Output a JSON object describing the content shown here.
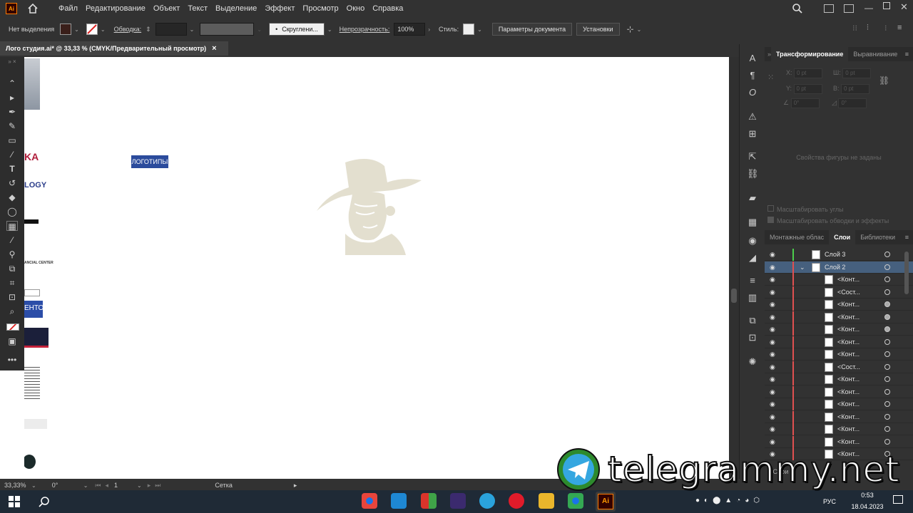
{
  "app": {
    "logo_text": "Ai",
    "menu": [
      "Файл",
      "Редактирование",
      "Объект",
      "Текст",
      "Выделение",
      "Эффект",
      "Просмотр",
      "Окно",
      "Справка"
    ]
  },
  "control_bar": {
    "selection_label": "Нет выделения",
    "stroke_label": "Обводка:",
    "brush_label": "Скруглени...",
    "opacity_label": "Непрозрачность:",
    "opacity_value": "100%",
    "style_label": "Стиль:",
    "doc_params_label": "Параметры документа",
    "settings_label": "Установки"
  },
  "document": {
    "tab_title": "Лого студия.ai* @ 33,33 % (CMYK/Предварительный просмотр)",
    "close_glyph": "×"
  },
  "canvas": {
    "badge_text": "ЛОГОТИПЫ",
    "left_snippets": [
      "KA",
      "LOGY",
      "ЕНТОВ",
      "ANCIAL CENTER"
    ]
  },
  "status_bar": {
    "zoom": "33,33%",
    "rotation": "0°",
    "artboard_number": "1",
    "grid_label": "Сетка"
  },
  "transform_panel": {
    "tabs": [
      "Трансформирование",
      "Выравнивание"
    ],
    "x_label": "X:",
    "y_label": "Y:",
    "w_label": "Ш:",
    "h_label": "В:",
    "x_value": "0 pt",
    "y_value": "0 pt",
    "w_value": "0 pt",
    "h_value": "0 pt",
    "angle_value": "0°",
    "shear_value": "0°",
    "no_shape_text": "Свойства фигуры не заданы",
    "scale_corners": "Масштабировать углы",
    "scale_strokes": "Масштабировать обводки и эффекты"
  },
  "layers_panel": {
    "tabs": [
      "Монтажные облас",
      "Слои",
      "Библиотеки"
    ],
    "rows": [
      {
        "name": "Слой 3",
        "indent": false,
        "selected": false,
        "color": "#4ccf4c",
        "target_filled": false
      },
      {
        "name": "Слой 2",
        "indent": false,
        "selected": true,
        "color": "#e05050",
        "target_filled": false
      },
      {
        "name": "<Конт...",
        "indent": true,
        "selected": false,
        "color": "#e05050",
        "target_filled": false
      },
      {
        "name": "<Сост...",
        "indent": true,
        "selected": false,
        "color": "#e05050",
        "target_filled": false
      },
      {
        "name": "<Конт...",
        "indent": true,
        "selected": false,
        "color": "#e05050",
        "target_filled": true
      },
      {
        "name": "<Конт...",
        "indent": true,
        "selected": false,
        "color": "#e05050",
        "target_filled": true
      },
      {
        "name": "<Конт...",
        "indent": true,
        "selected": false,
        "color": "#e05050",
        "target_filled": true
      },
      {
        "name": "<Конт...",
        "indent": true,
        "selected": false,
        "color": "#e05050",
        "target_filled": false
      },
      {
        "name": "<Конт...",
        "indent": true,
        "selected": false,
        "color": "#e05050",
        "target_filled": false
      },
      {
        "name": "<Сост...",
        "indent": true,
        "selected": false,
        "color": "#e05050",
        "target_filled": false
      },
      {
        "name": "<Конт...",
        "indent": true,
        "selected": false,
        "color": "#e05050",
        "target_filled": false
      },
      {
        "name": "<Конт...",
        "indent": true,
        "selected": false,
        "color": "#e05050",
        "target_filled": false
      },
      {
        "name": "<Конт...",
        "indent": true,
        "selected": false,
        "color": "#e05050",
        "target_filled": false
      },
      {
        "name": "<Конт...",
        "indent": true,
        "selected": false,
        "color": "#e05050",
        "target_filled": false
      },
      {
        "name": "<Конт...",
        "indent": true,
        "selected": false,
        "color": "#e05050",
        "target_filled": false
      },
      {
        "name": "<Конт...",
        "indent": true,
        "selected": false,
        "color": "#e05050",
        "target_filled": false
      },
      {
        "name": "<Конт...",
        "indent": true,
        "selected": false,
        "color": "#e05050",
        "target_filled": false
      }
    ],
    "footer": "3 Слои"
  },
  "taskbar": {
    "language": "РУС",
    "time": "0:53",
    "date": "18.04.2023"
  },
  "watermark": {
    "text": "telegrammy.net"
  }
}
